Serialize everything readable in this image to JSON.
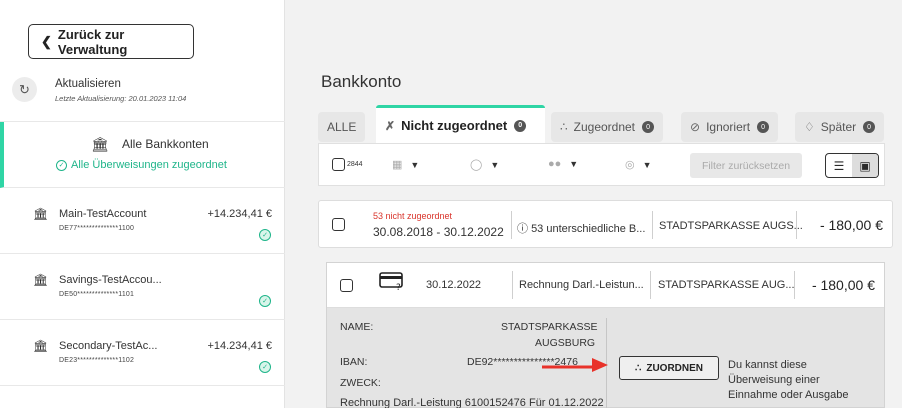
{
  "sidebar": {
    "back_label": "Zurück zur Verwaltung",
    "refresh_title": "Aktualisieren",
    "refresh_sub": "Letzte Aktualisierung: 20.01.2023 11:04",
    "all_accounts_label": "Alle Bankkonten",
    "all_assigned_status": "Alle Überweisungen zugeordnet",
    "accounts": [
      {
        "name": "Main-TestAccount",
        "iban": "DE77**************1100",
        "amount": "+14.234,41 €"
      },
      {
        "name": "Savings-TestAccou...",
        "iban": "DE50**************1101",
        "amount": ""
      },
      {
        "name": "Secondary-TestAc...",
        "iban": "DE23**************1102",
        "amount": "+14.234,41 €"
      }
    ]
  },
  "main": {
    "title": "Bankkonto",
    "tabs": [
      {
        "label": "ALLE",
        "count": ""
      },
      {
        "label": "Nicht zugeordnet",
        "count": "0"
      },
      {
        "label": "Zugeordnet",
        "count": "0"
      },
      {
        "label": "Ignoriert",
        "count": "0"
      },
      {
        "label": "Später",
        "count": "0"
      }
    ],
    "filter": {
      "select_count": "2844",
      "reset_label": "Filter zurücksetzen"
    },
    "group": {
      "status": "53 nicht zugeordnet",
      "date_range": "30.08.2018 - 30.12.2022",
      "info": "53 unterschiedliche B...",
      "bank": "STADTSPARKASSE AUGS...",
      "amount": "- 180,00 €"
    },
    "transaction": {
      "date": "30.12.2022",
      "purpose_short": "Rechnung Darl.-Leistun...",
      "bank": "STADTSPARKASSE AUG...",
      "amount": "- 180,00 €"
    },
    "details": {
      "name_label": "NAME:",
      "name_value_1": "STADTSPARKASSE",
      "name_value_2": "AUGSBURG",
      "iban_label": "IBAN:",
      "iban_value": "DE92***************2476",
      "purpose_label": "ZWECK:",
      "purpose_value": "Rechnung Darl.-Leistung 6100152476 Für 01.12.2022",
      "assign_label": "ZUORDNEN",
      "hint": "Du kannst diese Überweisung einer Einnahme oder Ausgabe"
    }
  },
  "colors": {
    "accent": "#2fd5a5",
    "warning": "#d9342b",
    "arrow": "#e8322a"
  }
}
